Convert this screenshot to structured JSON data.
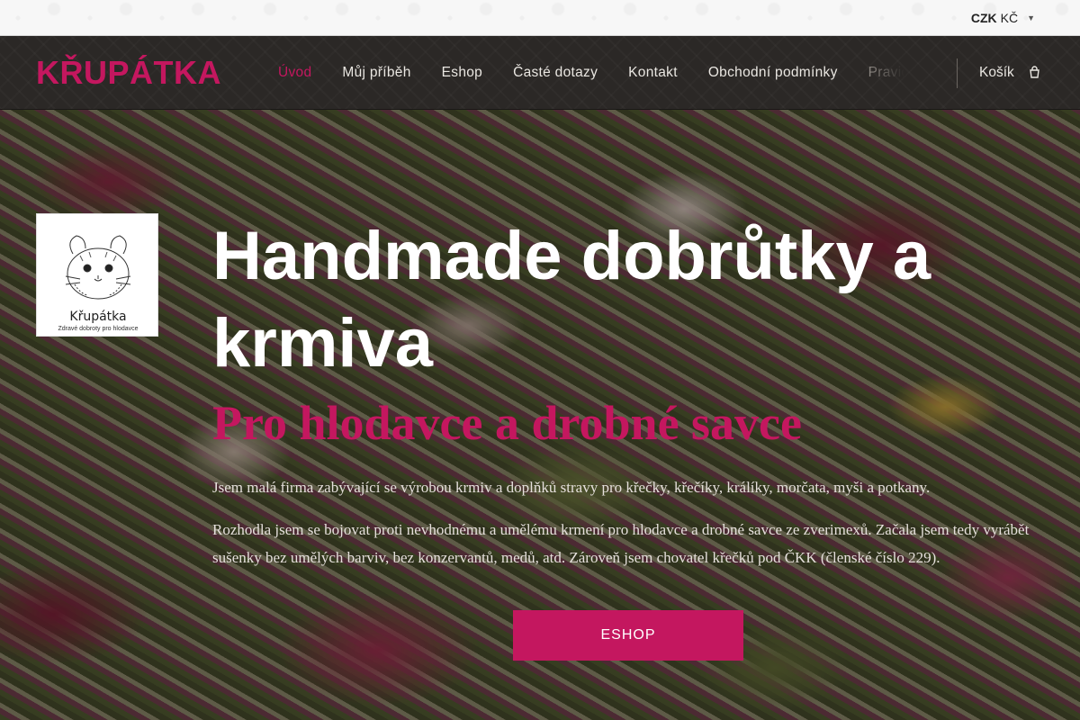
{
  "topbar": {
    "currency_code": "CZK",
    "currency_label": "KČ",
    "dropdown_icon": "chevron-down-icon"
  },
  "header": {
    "logo": "KŘUPÁTKA",
    "nav": [
      {
        "label": "Úvod",
        "active": true
      },
      {
        "label": "Můj příběh"
      },
      {
        "label": "Eshop"
      },
      {
        "label": "Časté dotazy"
      },
      {
        "label": "Kontakt"
      },
      {
        "label": "Obchodní podmínky"
      },
      {
        "label": "Pravid"
      }
    ],
    "cart_label": "Košík",
    "cart_icon": "cart-icon"
  },
  "hero": {
    "badge": {
      "name": "Křupátka",
      "subtitle": "Zdravé dobroty pro hlodavce"
    },
    "title": "Handmade dobrůtky a krmiva",
    "subtitle": "Pro hlodavce a drobné savce",
    "paragraph1": "Jsem malá firma zabývající se výrobou krmiv a doplňků stravy pro křečky, křečíky, králíky, morčata, myši a potkany.",
    "paragraph2": "Rozhodla jsem se bojovat proti nevhodnému a umělému krmení pro hlodavce a drobné savce ze zverimexů. Začala jsem tedy vyrábět sušenky bez umělých barviv, bez konzervantů, medů, atd. Zároveň jsem chovatel křečků pod ČKK (členské číslo 229).",
    "cta_label": "ESHOP"
  },
  "colors": {
    "accent": "#c4175f",
    "header_bg": "#2b2826",
    "topbar_bg": "#f7f7f7"
  }
}
